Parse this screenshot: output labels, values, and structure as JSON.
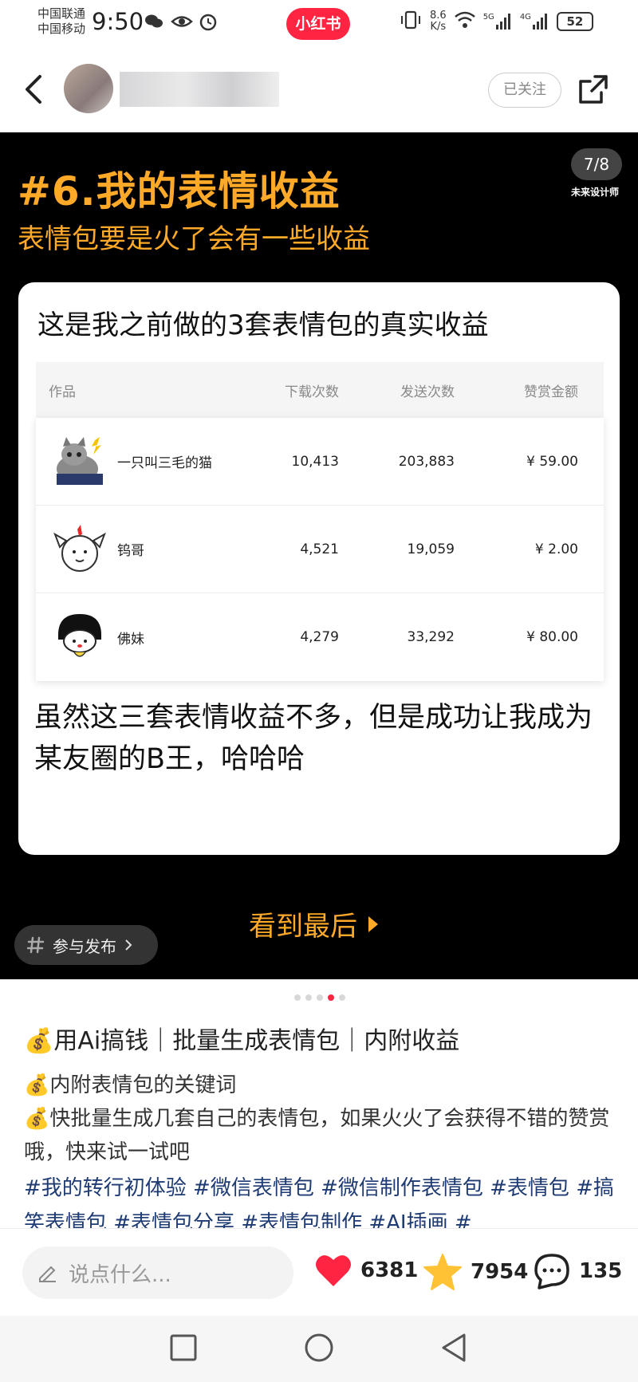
{
  "status_bar": {
    "carrier1": "中国联通",
    "carrier2": "中国移动",
    "time": "9:50",
    "app_badge": "小红书",
    "net_speed_value": "8.6",
    "net_speed_unit": "K/s",
    "signal1": "5G",
    "signal2": "4G",
    "battery": "52"
  },
  "header": {
    "follow_label": "已关注"
  },
  "slide": {
    "title": "#6.我的表情收益",
    "subtitle": "表情包要是火了会有一些收益",
    "counter": "7/8",
    "logo_text": "未来设计师",
    "card_heading": "这是我之前做的3套表情包的真实收益",
    "table": {
      "headers": [
        "作品",
        "下载次数",
        "发送次数",
        "赞赏金额"
      ],
      "rows": [
        {
          "name": "一只叫三毛的猫",
          "downloads": "10,413",
          "sends": "203,883",
          "tips": "¥ 59.00"
        },
        {
          "name": "钨哥",
          "downloads": "4,521",
          "sends": "19,059",
          "tips": "¥ 2.00"
        },
        {
          "name": "佛妹",
          "downloads": "4,279",
          "sends": "33,292",
          "tips": "¥ 80.00"
        }
      ]
    },
    "card_paragraph": "虽然这三套表情收益不多，但是成功让我成为某友圈的B王，哈哈哈",
    "see_end_label": "看到最后",
    "join_label": "参与发布"
  },
  "carousel": {
    "total": 5,
    "active_index": 3
  },
  "note": {
    "title": "💰用Ai搞钱｜批量生成表情包｜内附收益",
    "line1": "💰内附表情包的关键词",
    "line2": "💰快批量生成几套自己的表情包，如果火火了会获得不错的赞赏哦，快来试一试吧",
    "tags": "#我的转行初体验 #微信表情包 #微信制作表情包 #表情包 #搞笑表情包 #表情包分享 #表情包制作 #AI插画 #"
  },
  "bottom_bar": {
    "comment_placeholder": "说点什么...",
    "likes": "6381",
    "stars": "7954",
    "comments": "135"
  },
  "colors": {
    "brand_red": "#ff2442",
    "accent_orange": "#ffa928",
    "tag_blue": "#1f3b73"
  }
}
